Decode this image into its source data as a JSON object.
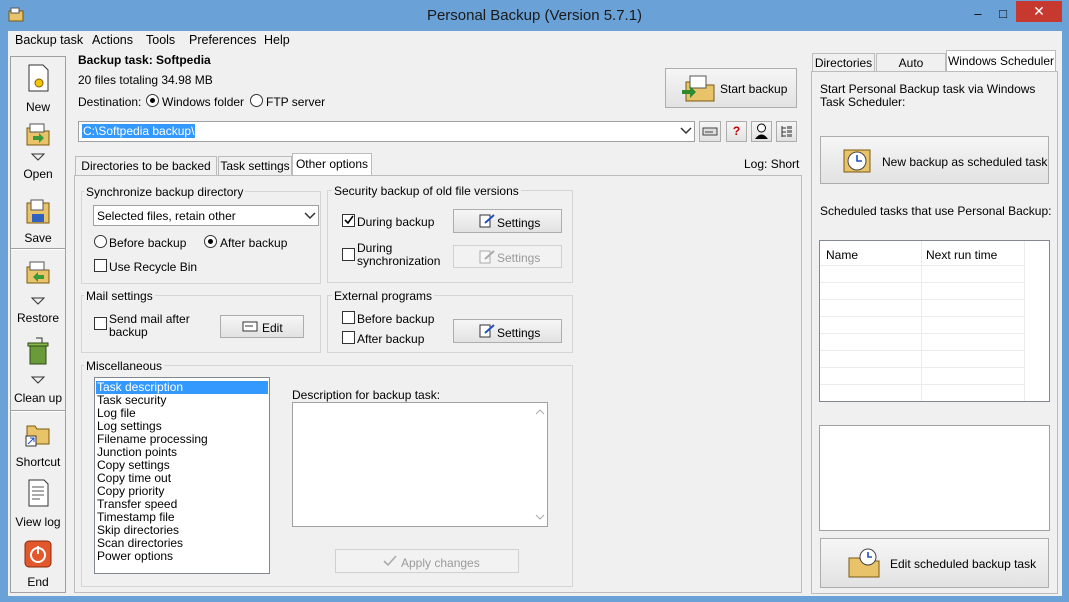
{
  "window": {
    "title": "Personal Backup (Version 5.7.1)",
    "minimize": "–",
    "maximize": "□",
    "close": "✕"
  },
  "menu": [
    "Backup task",
    "Actions",
    "Tools",
    "Preferences",
    "Help"
  ],
  "toolbar": {
    "new": "New",
    "open": "Open",
    "save": "Save",
    "restore": "Restore",
    "cleanup": "Clean up",
    "shortcut": "Shortcut",
    "viewlog": "View log",
    "end": "End"
  },
  "task": {
    "title": "Backup task: Softpedia",
    "summary": "20 files totaling 34.98 MB",
    "destination_label": "Destination:",
    "dest_windows": "Windows folder",
    "dest_ftp": "FTP server",
    "path": "C:\\Softpedia backup\\",
    "start_backup": "Start backup",
    "log_label": "Log: Short"
  },
  "tabs": [
    "Directories to be backed up",
    "Task settings",
    "Other options"
  ],
  "sync": {
    "title": "Synchronize backup directory",
    "select_value": "Selected files, retain other",
    "before": "Before backup",
    "after": "After backup",
    "recycle": "Use Recycle Bin"
  },
  "security": {
    "title": "Security backup of old file versions",
    "during_backup": "During backup",
    "during_sync_1": "During",
    "during_sync_2": "synchronization",
    "settings": "Settings"
  },
  "mail": {
    "title": "Mail settings",
    "send_1": "Send mail after",
    "send_2": "backup",
    "edit": "Edit"
  },
  "external": {
    "title": "External programs",
    "before": "Before backup",
    "after": "After backup",
    "settings": "Settings"
  },
  "misc": {
    "title": "Miscellaneous",
    "items": [
      "Task description",
      "Task security",
      "Log file",
      "Log settings",
      "Filename processing",
      "Junction points",
      "Copy settings",
      "Copy time out",
      "Copy priority",
      "Transfer speed",
      "Timestamp file",
      "Skip directories",
      "Scan directories",
      "Power options"
    ],
    "desc_label": "Description for backup task:",
    "apply": "Apply changes"
  },
  "right": {
    "tabs": [
      "Directories",
      "Auto Backup",
      "Windows Scheduler"
    ],
    "intro": "Start Personal Backup task via Windows Task Scheduler:",
    "new_task": "New backup as scheduled task",
    "scheduled_label": "Scheduled tasks that use Personal Backup:",
    "col_name": "Name",
    "col_next": "Next run time",
    "edit_task": "Edit scheduled backup task"
  },
  "colors": {
    "titlebar": "#6aa2d8",
    "selection": "#3399ff",
    "close": "#c7392f"
  }
}
